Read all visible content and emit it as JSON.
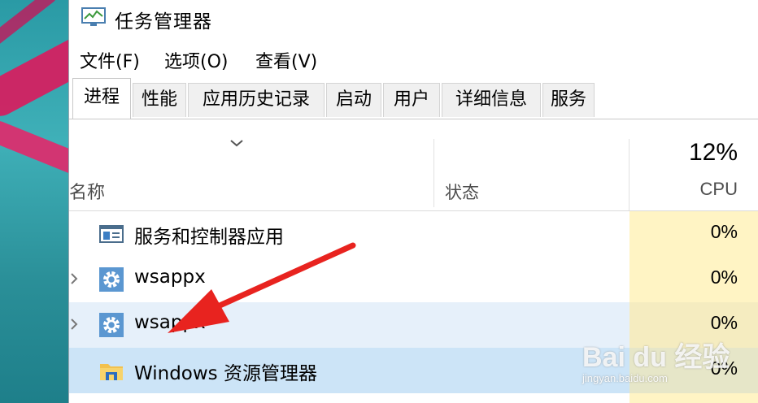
{
  "window": {
    "title": "任务管理器"
  },
  "menu": {
    "file": "文件(F)",
    "options": "选项(O)",
    "view": "查看(V)"
  },
  "tabs": [
    {
      "label": "进程",
      "active": true
    },
    {
      "label": "性能"
    },
    {
      "label": "应用历史记录"
    },
    {
      "label": "启动"
    },
    {
      "label": "用户"
    },
    {
      "label": "详细信息"
    },
    {
      "label": "服务"
    }
  ],
  "columns": {
    "name": "名称",
    "status": "状态",
    "cpu_percent": "12%",
    "cpu_label": "CPU"
  },
  "rows": [
    {
      "name": "服务和控制器应用",
      "cpu": "0%",
      "icon": "services-window-icon",
      "expandable": false
    },
    {
      "name": "wsappx",
      "cpu": "0%",
      "icon": "gear-icon",
      "expandable": true
    },
    {
      "name": "wsappx",
      "cpu": "0%",
      "icon": "gear-icon",
      "expandable": true,
      "hover": true
    },
    {
      "name": "Windows 资源管理器",
      "cpu": "0%",
      "icon": "folder-icon",
      "expandable": false,
      "selected": true
    }
  ],
  "watermark": {
    "logo": "Bai du 经验",
    "url": "jingyan.baidu.com"
  },
  "colors": {
    "cpu_column": "#fff4c4",
    "selected_row": "#cce4f7",
    "hover_row": "#e6f0fa",
    "arrow": "#e8231f"
  }
}
